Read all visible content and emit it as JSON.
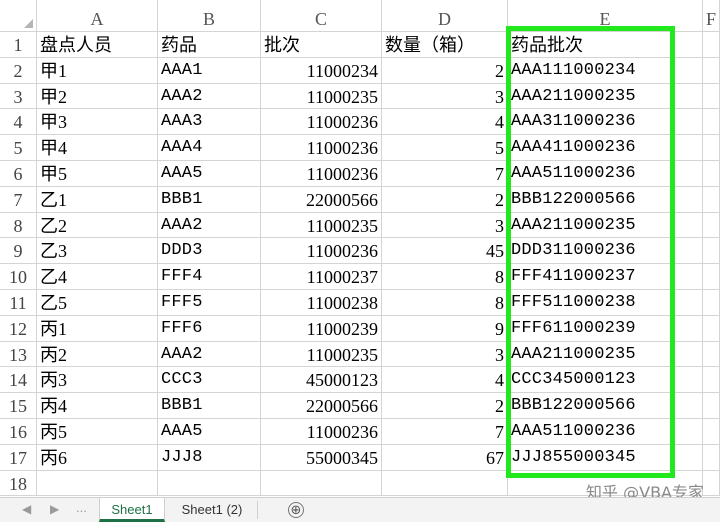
{
  "columns": [
    "A",
    "B",
    "C",
    "D",
    "E",
    "F"
  ],
  "rows": [
    {
      "n": "1",
      "a": "盘点人员",
      "b": "药品",
      "c": "批次",
      "d": "数量（箱）",
      "e": "药品批次"
    },
    {
      "n": "2",
      "a": "甲1",
      "b": "AAA1",
      "c": "11000234",
      "d": "2",
      "e": "AAA111000234"
    },
    {
      "n": "3",
      "a": "甲2",
      "b": "AAA2",
      "c": "11000235",
      "d": "3",
      "e": "AAA211000235"
    },
    {
      "n": "4",
      "a": "甲3",
      "b": "AAA3",
      "c": "11000236",
      "d": "4",
      "e": "AAA311000236"
    },
    {
      "n": "5",
      "a": "甲4",
      "b": "AAA4",
      "c": "11000236",
      "d": "5",
      "e": "AAA411000236"
    },
    {
      "n": "6",
      "a": "甲5",
      "b": "AAA5",
      "c": "11000236",
      "d": "7",
      "e": "AAA511000236"
    },
    {
      "n": "7",
      "a": "乙1",
      "b": "BBB1",
      "c": "22000566",
      "d": "2",
      "e": "BBB122000566"
    },
    {
      "n": "8",
      "a": "乙2",
      "b": "AAA2",
      "c": "11000235",
      "d": "3",
      "e": "AAA211000235"
    },
    {
      "n": "9",
      "a": "乙3",
      "b": "DDD3",
      "c": "11000236",
      "d": "45",
      "e": "DDD311000236"
    },
    {
      "n": "10",
      "a": "乙4",
      "b": "FFF4",
      "c": "11000237",
      "d": "8",
      "e": "FFF411000237"
    },
    {
      "n": "11",
      "a": "乙5",
      "b": "FFF5",
      "c": "11000238",
      "d": "8",
      "e": "FFF511000238"
    },
    {
      "n": "12",
      "a": "丙1",
      "b": "FFF6",
      "c": "11000239",
      "d": "9",
      "e": "FFF611000239"
    },
    {
      "n": "13",
      "a": "丙2",
      "b": "AAA2",
      "c": "11000235",
      "d": "3",
      "e": "AAA211000235"
    },
    {
      "n": "14",
      "a": "丙3",
      "b": "CCC3",
      "c": "45000123",
      "d": "4",
      "e": "CCC345000123"
    },
    {
      "n": "15",
      "a": "丙4",
      "b": "BBB1",
      "c": "22000566",
      "d": "2",
      "e": "BBB122000566"
    },
    {
      "n": "16",
      "a": "丙5",
      "b": "AAA5",
      "c": "11000236",
      "d": "7",
      "e": "AAA511000236"
    },
    {
      "n": "17",
      "a": "丙6",
      "b": "JJJ8",
      "c": "55000345",
      "d": "67",
      "e": "JJJ855000345"
    },
    {
      "n": "18",
      "a": "",
      "b": "",
      "c": "",
      "d": "",
      "e": ""
    }
  ],
  "tabs": {
    "sheet1": "Sheet1",
    "sheet1_copy": "Sheet1 (2)",
    "add": "⊕"
  },
  "nav": {
    "left": "◀",
    "right": "▶",
    "dots": "..."
  },
  "watermark": "知乎 @VBA专家",
  "colors": {
    "highlight": "#22e81e",
    "active_tab": "#1e7145"
  }
}
